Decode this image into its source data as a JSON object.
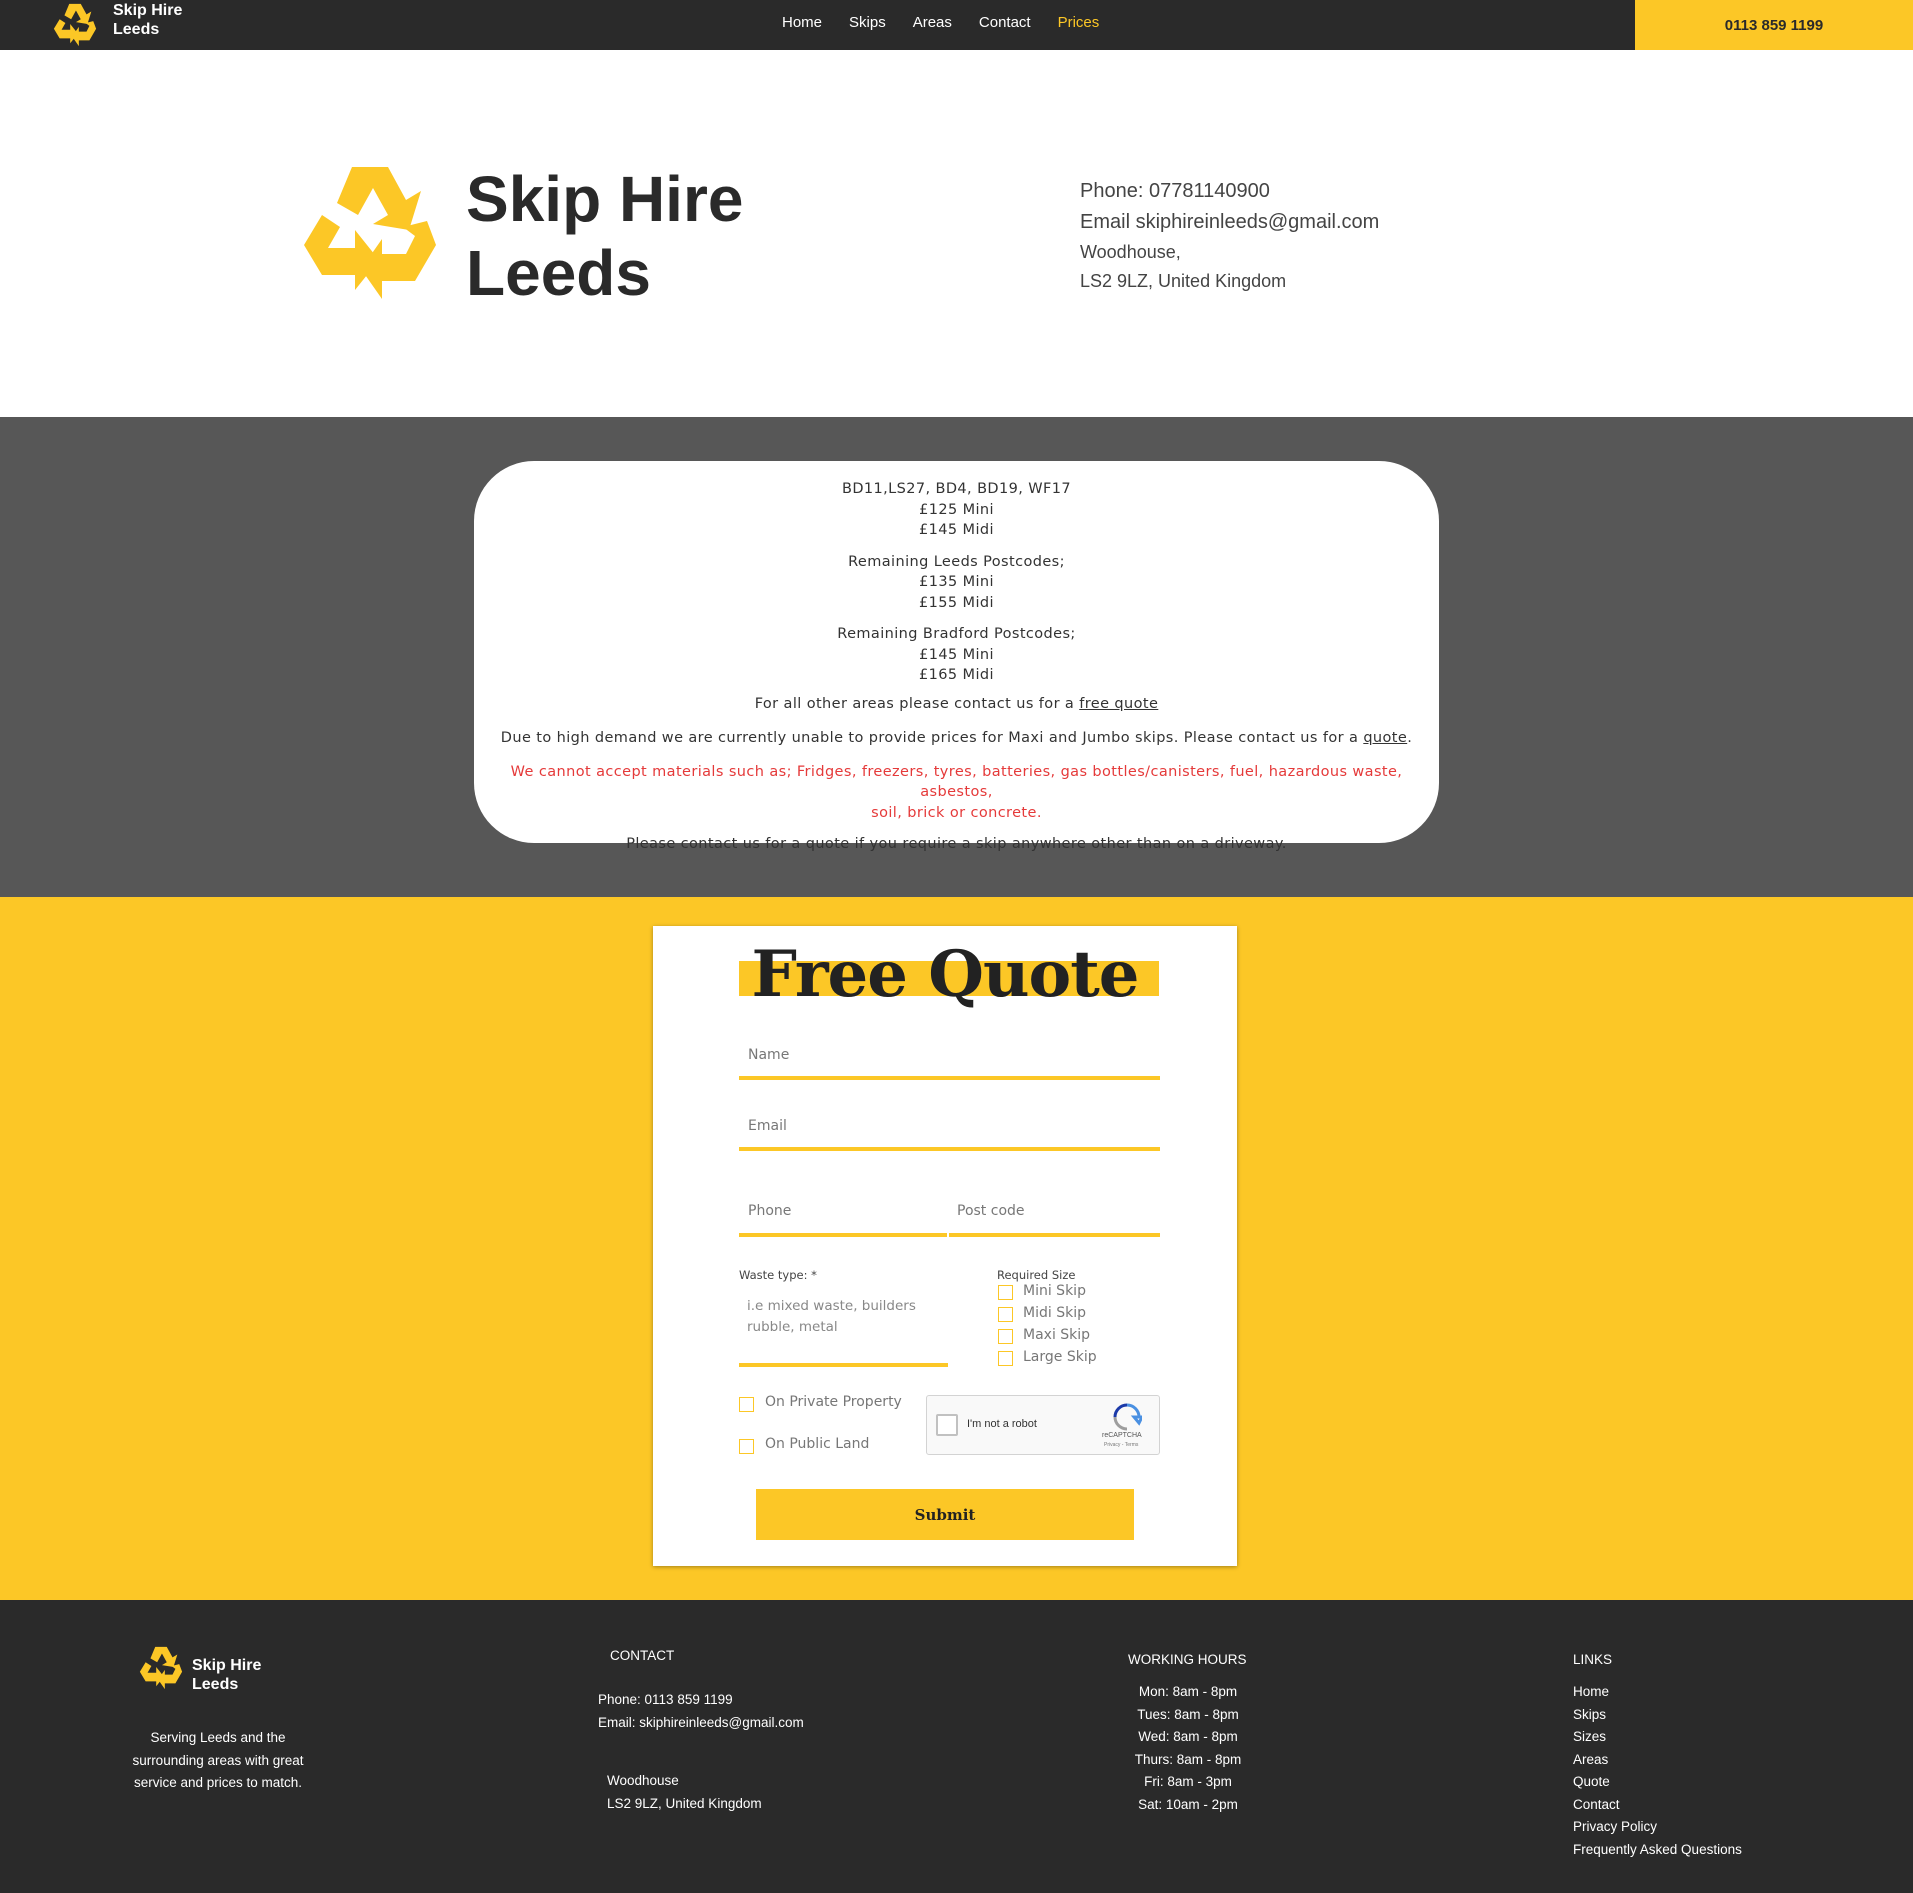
{
  "colors": {
    "accent": "#fcc726",
    "dark": "#2a2a2a",
    "grey": "#575757",
    "warning": "#e53a3a"
  },
  "topbar": {
    "brand_line1": "Skip Hire",
    "brand_line2": "Leeds",
    "nav": [
      "Home",
      "Skips",
      "Areas",
      "Contact",
      "Prices"
    ],
    "active_nav": "Prices",
    "phone_button": "0113 859 1199"
  },
  "header": {
    "title_line1": "Skip Hire",
    "title_line2": "Leeds",
    "phone": "Phone: 07781140900",
    "email": "Email skiphireinleeds@gmail.com",
    "address_line1": "Woodhouse,",
    "address_line2": "LS2 9LZ, United Kingdom",
    "logo_icon": "recycle-icon"
  },
  "prices": {
    "group1": {
      "areas": "BD11,LS27, BD4, BD19, WF17",
      "mini": "£125 Mini",
      "midi": "£145 Midi"
    },
    "group2": {
      "areas": "Remaining Leeds Postcodes;",
      "mini": "£135 Mini",
      "midi": "£155 Midi"
    },
    "group3": {
      "areas": "Remaining Bradford Postcodes;",
      "mini": "£145 Mini",
      "midi": "£165 Midi"
    },
    "other_areas_prefix": "For all other areas please contact us for a ",
    "other_areas_link": "free quote",
    "demand_prefix": "Due to high demand we are currently unable to provide prices for Maxi and Jumbo skips. Please contact us for a ",
    "demand_link": "quote",
    "demand_suffix": ".",
    "warning_line1": "We cannot accept materials such as; Fridges, freezers, tyres, batteries, gas bottles/canisters, fuel, hazardous waste, asbestos,",
    "warning_line2": "soil, brick or concrete.",
    "driveway_note": "Please contact us for a quote if you require a skip anywhere other than on a driveway."
  },
  "quote_form": {
    "title": "Free Quote",
    "name_label": "Name",
    "email_label": "Email",
    "phone_label": "Phone",
    "postcode_label": "Post code",
    "waste_label": "Waste type: *",
    "waste_placeholder_line1": "i.e mixed waste, builders",
    "waste_placeholder_line2": "rubble, metal",
    "size_label": "Required Size",
    "sizes": [
      "Mini Skip",
      "Midi Skip",
      "Maxi Skip",
      "Large Skip"
    ],
    "location_options": [
      "On Private Property",
      "On Public Land"
    ],
    "captcha_text": "I'm not a robot",
    "captcha_brand": "reCAPTCHA",
    "captcha_terms": "Privacy - Terms",
    "submit": "Submit"
  },
  "footer": {
    "brand_line1": "Skip Hire",
    "brand_line2": "Leeds",
    "tagline": [
      "Serving Leeds and the",
      "surrounding areas with great",
      "service and prices to match."
    ],
    "contact_heading": "CONTACT",
    "contact_phone": "Phone: 0113 859 1199",
    "contact_email": "Email: skiphireinleeds@gmail.com",
    "address_line1": "Woodhouse",
    "address_line2": "LS2 9LZ, United Kingdom",
    "hours_heading": "WORKING HOURS",
    "hours": [
      "Mon: 8am - 8pm",
      "Tues: 8am - 8pm",
      "Wed: 8am - 8pm",
      "Thurs: 8am - 8pm",
      "Fri: 8am - 3pm",
      "Sat: 10am - 2pm"
    ],
    "links_heading": "LINKS",
    "links": [
      "Home",
      "Skips",
      "Sizes",
      "Areas",
      "Quote",
      "Contact",
      "Privacy Policy",
      "Frequently Asked Questions"
    ]
  }
}
